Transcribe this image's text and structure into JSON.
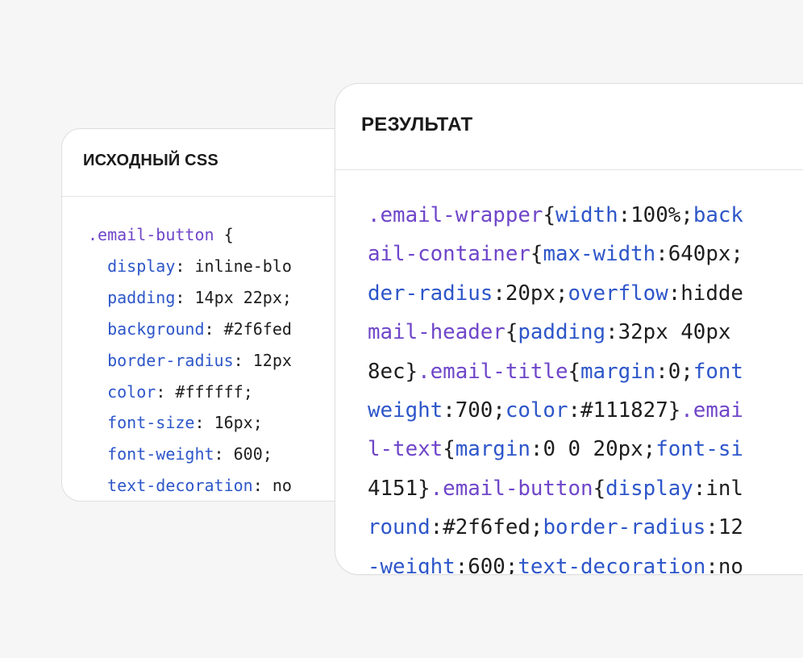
{
  "colors": {
    "selector": "#6f46c9",
    "property": "#2d56c9",
    "value": "#1e1e1e",
    "background": "#f6f6f6"
  },
  "source_panel": {
    "title": "ИСХОДНЫЙ CSS",
    "lines": [
      [
        {
          "t": "sel",
          "v": ".email-button"
        },
        {
          "t": "punc",
          "v": " {"
        }
      ],
      [
        {
          "t": "punc",
          "v": "  "
        },
        {
          "t": "prop",
          "v": "display"
        },
        {
          "t": "punc",
          "v": ": "
        },
        {
          "t": "val",
          "v": "inline-blo"
        }
      ],
      [
        {
          "t": "punc",
          "v": "  "
        },
        {
          "t": "prop",
          "v": "padding"
        },
        {
          "t": "punc",
          "v": ": "
        },
        {
          "t": "val",
          "v": "14px 22px;"
        }
      ],
      [
        {
          "t": "punc",
          "v": "  "
        },
        {
          "t": "prop",
          "v": "background"
        },
        {
          "t": "punc",
          "v": ": "
        },
        {
          "t": "val",
          "v": "#2f6fed"
        }
      ],
      [
        {
          "t": "punc",
          "v": "  "
        },
        {
          "t": "prop",
          "v": "border-radius"
        },
        {
          "t": "punc",
          "v": ": "
        },
        {
          "t": "val",
          "v": "12px"
        }
      ],
      [
        {
          "t": "punc",
          "v": "  "
        },
        {
          "t": "prop",
          "v": "color"
        },
        {
          "t": "punc",
          "v": ": "
        },
        {
          "t": "val",
          "v": "#ffffff;"
        }
      ],
      [
        {
          "t": "punc",
          "v": "  "
        },
        {
          "t": "prop",
          "v": "font-size"
        },
        {
          "t": "punc",
          "v": ": "
        },
        {
          "t": "val",
          "v": "16px;"
        }
      ],
      [
        {
          "t": "punc",
          "v": "  "
        },
        {
          "t": "prop",
          "v": "font-weight"
        },
        {
          "t": "punc",
          "v": ": "
        },
        {
          "t": "val",
          "v": "600;"
        }
      ],
      [
        {
          "t": "punc",
          "v": "  "
        },
        {
          "t": "prop",
          "v": "text-decoration"
        },
        {
          "t": "punc",
          "v": ": "
        },
        {
          "t": "val",
          "v": "no"
        }
      ],
      [
        {
          "t": "punc",
          "v": "}"
        }
      ]
    ]
  },
  "result_panel": {
    "title": "РЕЗУЛЬТАТ",
    "lines": [
      [
        {
          "t": "sel",
          "v": ".email-wrapper"
        },
        {
          "t": "punc",
          "v": "{"
        },
        {
          "t": "prop",
          "v": "width"
        },
        {
          "t": "punc",
          "v": ":"
        },
        {
          "t": "val",
          "v": "100%;"
        },
        {
          "t": "prop",
          "v": "back"
        }
      ],
      [
        {
          "t": "sel",
          "v": "ail-container"
        },
        {
          "t": "punc",
          "v": "{"
        },
        {
          "t": "prop",
          "v": "max-width"
        },
        {
          "t": "punc",
          "v": ":"
        },
        {
          "t": "val",
          "v": "640px;"
        }
      ],
      [
        {
          "t": "prop",
          "v": "der-radius"
        },
        {
          "t": "punc",
          "v": ":"
        },
        {
          "t": "val",
          "v": "20px;"
        },
        {
          "t": "prop",
          "v": "overflow"
        },
        {
          "t": "punc",
          "v": ":"
        },
        {
          "t": "val",
          "v": "hidde"
        }
      ],
      [
        {
          "t": "sel",
          "v": "mail-header"
        },
        {
          "t": "punc",
          "v": "{"
        },
        {
          "t": "prop",
          "v": "padding"
        },
        {
          "t": "punc",
          "v": ":"
        },
        {
          "t": "val",
          "v": "32px 40px"
        }
      ],
      [
        {
          "t": "val",
          "v": "8ec}"
        },
        {
          "t": "sel",
          "v": ".email-title"
        },
        {
          "t": "punc",
          "v": "{"
        },
        {
          "t": "prop",
          "v": "margin"
        },
        {
          "t": "punc",
          "v": ":"
        },
        {
          "t": "val",
          "v": "0;"
        },
        {
          "t": "prop",
          "v": "font"
        }
      ],
      [
        {
          "t": "prop",
          "v": "weight"
        },
        {
          "t": "punc",
          "v": ":"
        },
        {
          "t": "val",
          "v": "700;"
        },
        {
          "t": "prop",
          "v": "color"
        },
        {
          "t": "punc",
          "v": ":"
        },
        {
          "t": "val",
          "v": "#111827}"
        },
        {
          "t": "sel",
          "v": ".emai"
        }
      ],
      [
        {
          "t": "sel",
          "v": "l-text"
        },
        {
          "t": "punc",
          "v": "{"
        },
        {
          "t": "prop",
          "v": "margin"
        },
        {
          "t": "punc",
          "v": ":"
        },
        {
          "t": "val",
          "v": "0 0 20px;"
        },
        {
          "t": "prop",
          "v": "font-si"
        }
      ],
      [
        {
          "t": "val",
          "v": "4151}"
        },
        {
          "t": "sel",
          "v": ".email-button"
        },
        {
          "t": "punc",
          "v": "{"
        },
        {
          "t": "prop",
          "v": "display"
        },
        {
          "t": "punc",
          "v": ":"
        },
        {
          "t": "val",
          "v": "inl"
        }
      ],
      [
        {
          "t": "prop",
          "v": "round"
        },
        {
          "t": "punc",
          "v": ":"
        },
        {
          "t": "val",
          "v": "#2f6fed;"
        },
        {
          "t": "prop",
          "v": "border-radius"
        },
        {
          "t": "punc",
          "v": ":"
        },
        {
          "t": "val",
          "v": "12"
        }
      ],
      [
        {
          "t": "prop",
          "v": "-weight"
        },
        {
          "t": "punc",
          "v": ":"
        },
        {
          "t": "val",
          "v": "600;"
        },
        {
          "t": "prop",
          "v": "text-decoration"
        },
        {
          "t": "punc",
          "v": ":"
        },
        {
          "t": "val",
          "v": "no"
        }
      ]
    ]
  }
}
